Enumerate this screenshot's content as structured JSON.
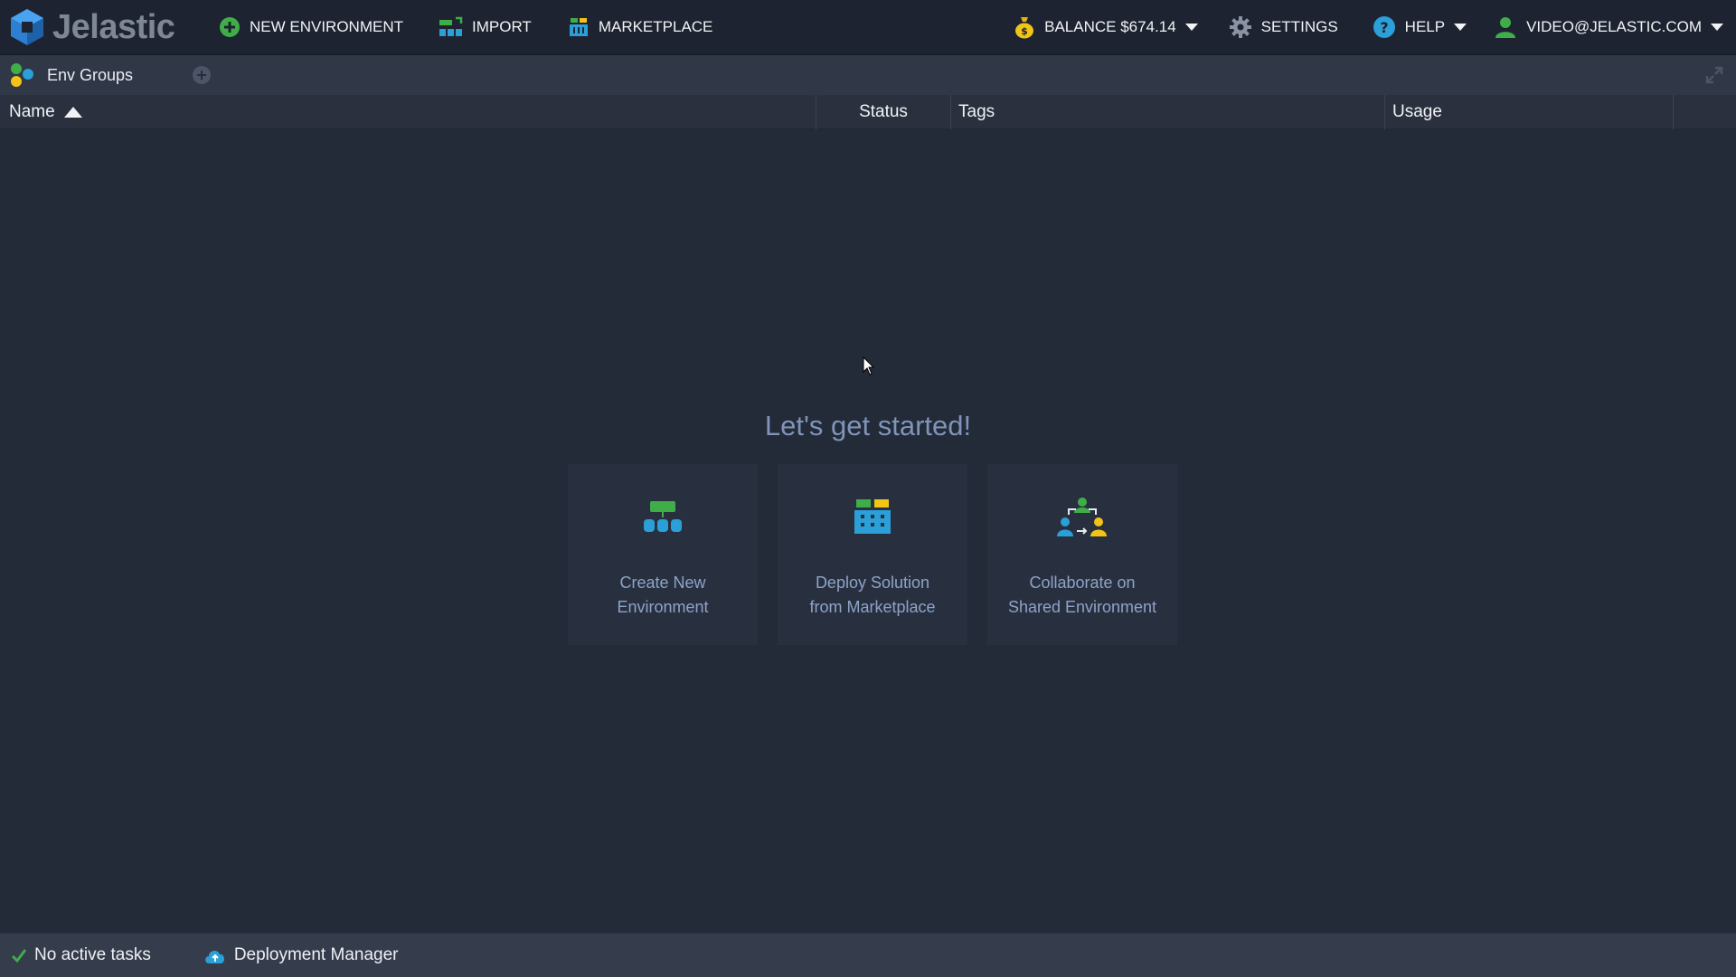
{
  "brand": {
    "logo_text": "Jelastic"
  },
  "topbar": {
    "new_environment": "NEW ENVIRONMENT",
    "import": "IMPORT",
    "marketplace": "MARKETPLACE",
    "balance": "BALANCE $674.14",
    "settings": "SETTINGS",
    "help": "HELP",
    "account": "VIDEO@JELASTIC.COM"
  },
  "subbar": {
    "env_groups": "Env Groups"
  },
  "grid": {
    "columns": [
      "Name",
      "Status",
      "Tags",
      "Usage"
    ],
    "sort": "ascending"
  },
  "empty_state": {
    "heading": "Let's get started!",
    "cards": [
      {
        "line1": "Create New",
        "line2": "Environment",
        "icon": "environment-topology-icon"
      },
      {
        "line1": "Deploy Solution",
        "line2": "from Marketplace",
        "icon": "marketplace-basket-icon"
      },
      {
        "line1": "Collaborate on",
        "line2": "Shared Environment",
        "icon": "shared-users-icon"
      }
    ]
  },
  "bottombar": {
    "tasks": "No active tasks",
    "deployment_manager": "Deployment Manager"
  },
  "colors": {
    "accent_green": "#3fae49",
    "accent_blue": "#2a9fd8",
    "accent_yellow": "#f2c417",
    "heading": "#7f94b8"
  }
}
